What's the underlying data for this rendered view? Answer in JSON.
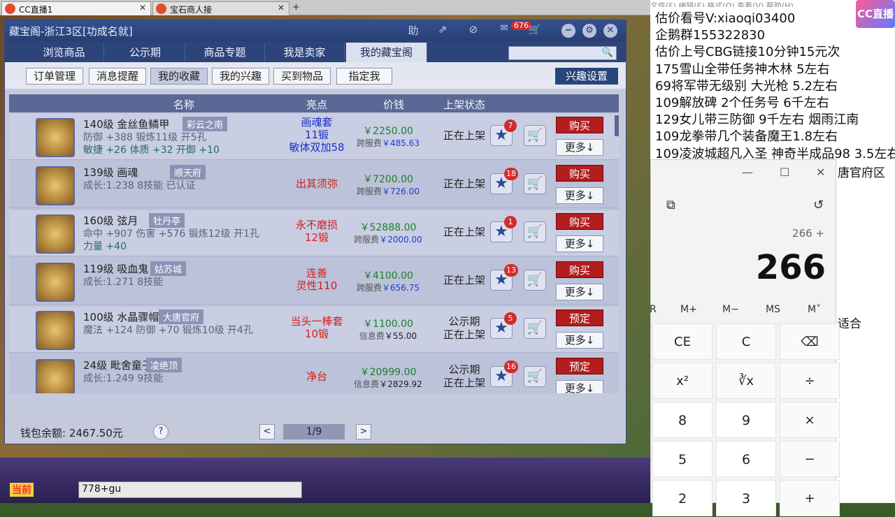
{
  "browser": {
    "tabs": [
      {
        "label": "CC直播1",
        "close": "✕"
      },
      {
        "label": "宝石商人接",
        "close": "✕"
      }
    ],
    "newtab": "+"
  },
  "window": {
    "title": "藏宝阁-浙江3区[功成名就]",
    "title_buttons": [
      "助",
      "⇗",
      "⊘"
    ],
    "message_badge": "676",
    "nav": [
      "浏览商品",
      "公示期",
      "商品专题",
      "我是卖家",
      "我的藏宝阁"
    ],
    "sub": [
      "订单管理",
      "消息提醒",
      "我的收藏",
      "我的兴趣",
      "买到物品",
      "指定我"
    ],
    "interest_button": "兴趣设置",
    "headers": [
      "名称",
      "亮点",
      "价钱",
      "上架状态"
    ],
    "rows": [
      {
        "name": "140级 金丝鱼鳞甲",
        "region": "彩云之南",
        "attr1": "防御 +388 锻炼11级 开5孔",
        "attr2": "敏捷 +26 体质 +32 开御 +10",
        "hl": [
          "画魂套",
          "11锻",
          "敏体双加58"
        ],
        "hlcolor": "blue",
        "price": "￥2250.00",
        "fee_label": "跨服费",
        "fee": "￥485.63",
        "status": [
          "正在上架"
        ],
        "stars": "7",
        "action": "购买",
        "more": "更多↓"
      },
      {
        "name": "139级 画魂",
        "region": "顺天府",
        "attr1": "成长:1.238 8技能 已认证",
        "attr2": "",
        "hl": [
          "出其须弥"
        ],
        "hlcolor": "red",
        "price": "￥7200.00",
        "fee_label": "跨服费",
        "fee": "￥726.00",
        "status": [
          "正在上架"
        ],
        "stars": "18",
        "action": "购买",
        "more": "更多↓"
      },
      {
        "name": "160级 弦月",
        "region": "牡丹亭",
        "attr1": "命中 +907 伤害 +576 锻炼12级 开1孔",
        "attr2": "力量 +40",
        "hl": [
          "永不磨损",
          "12锻"
        ],
        "hlcolor": "red",
        "price": "￥52888.00",
        "fee_label": "跨服费",
        "fee": "￥2000.00",
        "status": [
          "正在上架"
        ],
        "stars": "1",
        "action": "购买",
        "more": "更多↓"
      },
      {
        "name": "119级 吸血鬼",
        "region": "姑苏城",
        "attr1": "成长:1.271 8技能",
        "attr2": "",
        "hl": [
          "连善",
          "灵性110"
        ],
        "hlcolor": "red",
        "price": "￥4100.00",
        "fee_label": "跨服费",
        "fee": "￥656.75",
        "status": [
          "正在上架"
        ],
        "stars": "13",
        "action": "购买",
        "more": "更多↓"
      },
      {
        "name": "100级 水晶骤帽",
        "region": "大唐官府",
        "attr1": "魔法 +124 防御 +70 锻炼10级 开4孔",
        "attr2": "",
        "hl": [
          "当头一棒套",
          "10锻"
        ],
        "hlcolor": "red",
        "price": "￥1100.00",
        "fee_label": "信息费",
        "fee": "￥55.00",
        "status": [
          "公示期",
          "正在上架"
        ],
        "stars": "5",
        "action": "预定",
        "more": "更多↓"
      },
      {
        "name": "24级 毗舍童子",
        "region": "凌绝顶",
        "attr1": "成长:1.249 9技能",
        "attr2": "",
        "hl": [
          "净台"
        ],
        "hlcolor": "red",
        "price": "￥20999.00",
        "fee_label": "信息费",
        "fee": "￥2829.92",
        "status": [
          "公示期",
          "正在上架"
        ],
        "stars": "16",
        "action": "预定",
        "more": "更多↓"
      }
    ],
    "wallet": "钱包余额: 2467.50元",
    "help": "?",
    "page": "1/9",
    "prev": "<",
    "next": ">"
  },
  "game": {
    "current_channel": "当前",
    "chat_input": "778+gu"
  },
  "right": {
    "logo": "CC直播",
    "menu": "文件(F)  编辑(E)  格式(O)  查看(V)  帮助(H)",
    "lines": [
      "估价看号V:xiaoqi03400",
      "企鹅群155322830",
      "估价上号CBG链接10分钟15元次",
      "175雪山全带任务神木林 5左右",
      "69将军带无级别 大光枪 5.2左右",
      "109解放碑 2个任务号 6千左右",
      "129女儿带三防御 9千左右 烟雨江南",
      "109龙拳带几个装备魔王1.8左右",
      "109凌波城超凡入圣 神奇半成品98 3.5左右"
    ],
    "behind": [
      "唐官府区",
      "适合"
    ]
  },
  "calc": {
    "controls": [
      "—",
      "☐",
      "✕"
    ],
    "expression": "266 +",
    "display": "266",
    "memory": [
      "M+",
      "M−",
      "MS",
      "M˅"
    ],
    "keys": [
      [
        "CE",
        "C",
        "⌫"
      ],
      [
        "x²",
        "∛x",
        "÷"
      ],
      [
        "8",
        "9",
        "×"
      ],
      [
        "5",
        "6",
        "−"
      ],
      [
        "2",
        "3",
        "+"
      ]
    ]
  }
}
